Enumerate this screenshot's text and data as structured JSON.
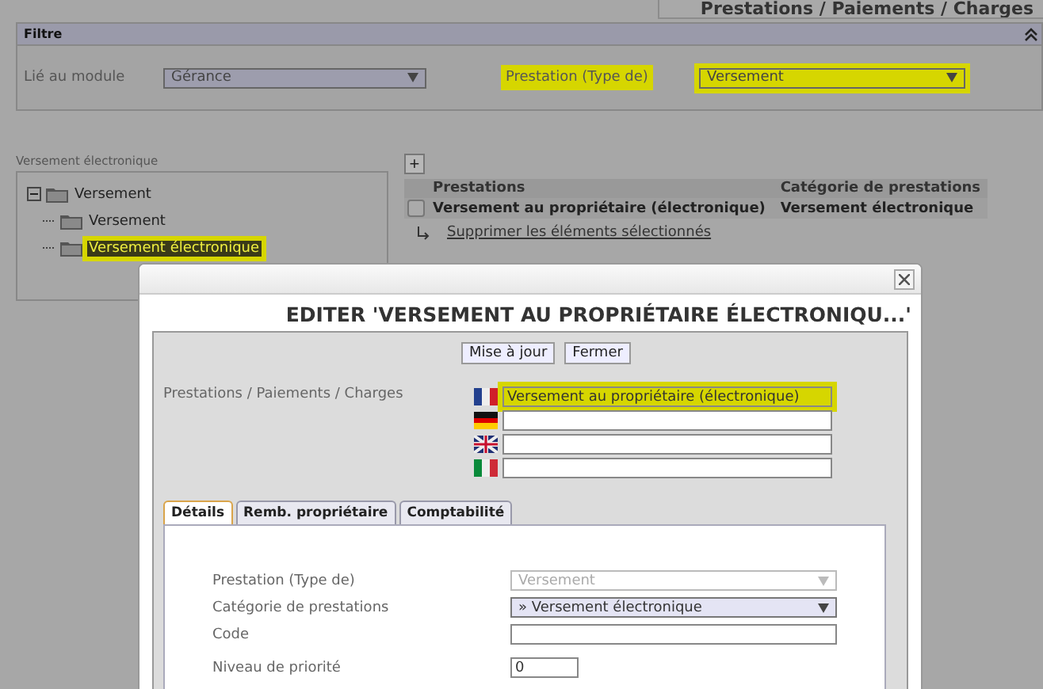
{
  "header": {
    "title": "Prestations / Paiements / Charges"
  },
  "filter": {
    "title": "Filtre",
    "fields": [
      {
        "label": "Lié au module",
        "value": "Gérance",
        "highlighted": false
      },
      {
        "label": "Prestation (Type de)",
        "value": "Versement",
        "highlighted": true
      }
    ]
  },
  "tree": {
    "caption": "Versement électronique",
    "items": [
      {
        "label": "Versement",
        "expanded": true,
        "selected": false,
        "highlighted": false,
        "children": [
          {
            "label": "Versement",
            "selected": false,
            "highlighted": false
          },
          {
            "label": "Versement électronique",
            "selected": true,
            "highlighted": true
          }
        ]
      }
    ]
  },
  "table": {
    "add_button": "+",
    "columns": [
      "Prestations",
      "Catégorie de prestations"
    ],
    "rows": [
      {
        "checked": false,
        "cells": [
          "Versement au propriétaire (électronique)",
          "Versement électronique"
        ]
      }
    ],
    "delete_link": "Supprimer les éléments sélectionnés"
  },
  "dialog": {
    "title": "EDITER 'VERSEMENT AU PROPRIÉTAIRE ÉLECTRONIQU...'",
    "buttons": [
      "Mise à jour",
      "Fermer"
    ],
    "name_label": "Prestations / Paiements / Charges",
    "names": [
      {
        "value": "Versement au propriétaire (électronique)",
        "highlighted": true
      },
      {
        "highlighted": false
      },
      {
        "highlighted": false
      },
      {
        "highlighted": false
      }
    ],
    "tabs": [
      {
        "label": "Détails",
        "selected": true
      },
      {
        "label": "Remb. propriétaire",
        "selected": false
      },
      {
        "label": "Comptabilité",
        "selected": false
      }
    ],
    "form": [
      {
        "label": "Prestation (Type de)",
        "kind": "select",
        "value": "Versement",
        "disabled": true
      },
      {
        "label": "Catégorie de prestations",
        "kind": "select",
        "value": "» Versement électronique",
        "disabled": false
      },
      {
        "label": "Code",
        "kind": "text"
      },
      {
        "label": "Niveau de priorité",
        "kind": "number",
        "value": "0"
      }
    ]
  }
}
